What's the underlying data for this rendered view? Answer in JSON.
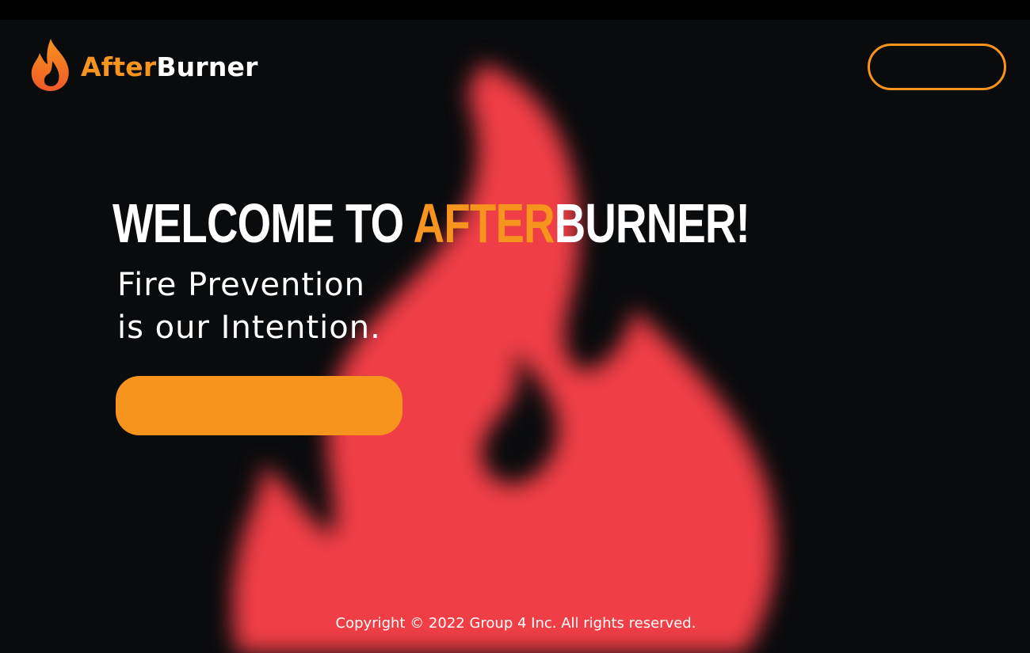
{
  "brand": {
    "name_part1": "After",
    "name_part2": "Burner",
    "logo_icon": "flame-icon",
    "accent_color": "#f7941d",
    "flame_color": "#f03e46"
  },
  "header": {
    "button_label": ""
  },
  "hero": {
    "title_prefix": "WELCOME TO ",
    "title_accent": "AFTER",
    "title_suffix": "BURNER!",
    "tagline_line1": "Fire Prevention",
    "tagline_line2": "is our Intention.",
    "cta_label": ""
  },
  "footer": {
    "copyright": "Copyright © 2022 Group 4 Inc. All rights reserved."
  }
}
